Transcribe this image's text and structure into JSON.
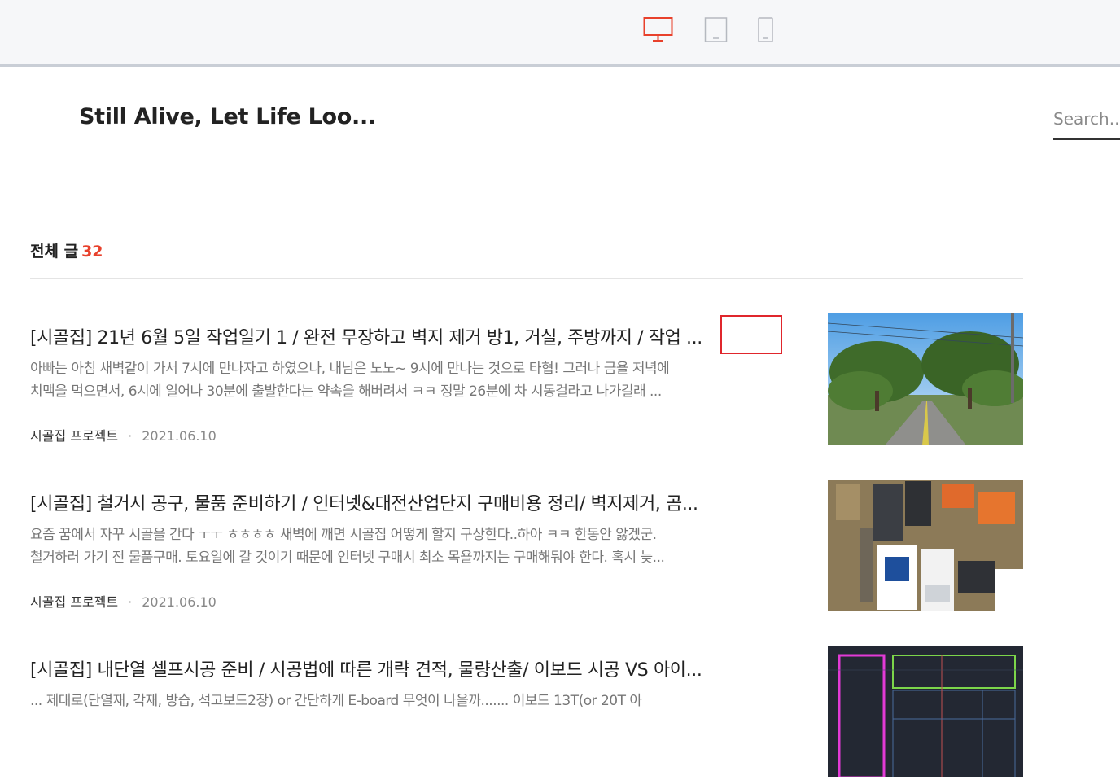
{
  "toolbar": {
    "devices": [
      "desktop-icon",
      "tablet-icon",
      "mobile-icon"
    ],
    "active_device": "desktop",
    "accent": "#e8412c"
  },
  "header": {
    "blog_title": "Still Alive, Let Life Loo...",
    "search_placeholder": "Search..."
  },
  "listing": {
    "label": "전체 글",
    "count": "32"
  },
  "posts": [
    {
      "title": "[시골집] 21년 6월 5일 작업일기 1 / 완전 무장하고 벽지 제거 방1, 거실, 주방까지 / 작업 ...",
      "excerpt_line1": "아빠는 아침 새벽같이 가서 7시에 만나자고 하였으나, 내님은 노노~ 9시에 만나는 것으로 타협! 그러나 금욜 저녁에",
      "excerpt_line2": "치맥을 먹으면서, 6시에 일어나 30분에 출발한다는 약속을 해버려서 ㅋㅋ 정말 26분에 차 시동걸라고 나가길래 ...",
      "category": "시골집 프로젝트",
      "date": "2021.06.10",
      "thumb": "road-with-trees"
    },
    {
      "title": "[시골집] 철거시 공구, 물품 준비하기 / 인터넷&대전산업단지 구매비용 정리/ 벽지제거, 곰...",
      "excerpt_line1": "요즘 꿈에서 자꾸 시골을 간다 ㅜㅜ ㅎㅎㅎㅎ 새벽에 깨면 시골집 어떻게 할지 구상한다..하아 ㅋㅋ 한동안 앓겠군.",
      "excerpt_line2": "철거하러 가기 전 물품구매. 토요일에 갈 것이기 때문에 인터넷 구매시 최소 목욜까지는 구매해둬야 한다. 혹시 늦...",
      "category": "시골집 프로젝트",
      "date": "2021.06.10",
      "thumb": "tools-and-gloves"
    },
    {
      "title": "[시골집] 내단열 셀프시공 준비 / 시공법에 따른 개략 견적, 물량산출/ 이보드 시공 VS 아이...",
      "excerpt_line1": "... 제대로(단열재, 각재, 방습, 석고보드2장) or 간단하게 E-board 무엇이 나을까....... 이보드 13T(or 20T 아",
      "excerpt_line2": "",
      "category": "",
      "date": "",
      "thumb": "cad-floor-plan"
    }
  ]
}
